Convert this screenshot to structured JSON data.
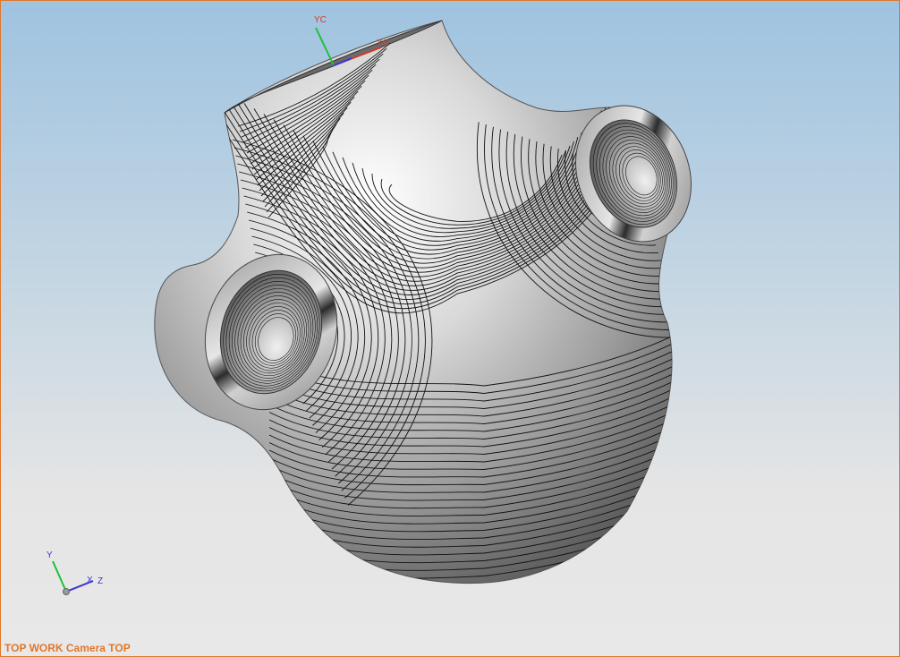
{
  "view": {
    "label": "TOP WORK Camera TOP",
    "border_color": "#e0772b",
    "background_top": "#9fc3e0",
    "background_bottom": "#e8e8e8"
  },
  "model": {
    "name": "sculpted-vessel-with-two-ports",
    "surface_color": "#bdbdbd",
    "contour_color": "#111111"
  },
  "wcs_triad": {
    "y_label": "YC",
    "x_label": "XC",
    "y_color": "#1fbf3a",
    "x_color": "#d23a2a",
    "z_color": "#3a3ad2"
  },
  "orientation_triad": {
    "y_label": "Y",
    "x_label": "X",
    "z_label": "Z",
    "y_color": "#1fbf3a",
    "x_color": "#d23a2a",
    "z_color": "#3a3ad2"
  }
}
